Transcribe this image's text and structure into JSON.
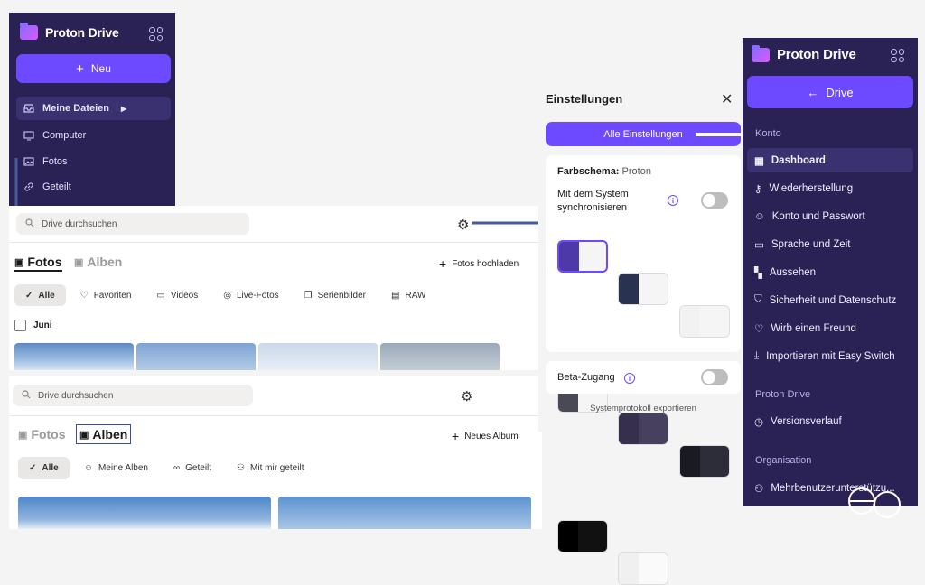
{
  "left_sidebar": {
    "brand": "Proton Drive",
    "new_label": "Neu",
    "items": [
      {
        "label": "Meine Dateien"
      },
      {
        "label": "Computer"
      },
      {
        "label": "Fotos"
      },
      {
        "label": "Geteilt"
      }
    ]
  },
  "photos_view": {
    "search_placeholder": "Drive durchsuchen",
    "tab_fotos": "Fotos",
    "tab_alben": "Alben",
    "upload_label": "Fotos hochladen",
    "filters": [
      "Alle",
      "Favoriten",
      "Videos",
      "Live-Fotos",
      "Serienbilder",
      "RAW"
    ],
    "month": "Juni"
  },
  "albums_view": {
    "search_placeholder": "Drive durchsuchen",
    "tab_fotos": "Fotos",
    "tab_alben": "Alben",
    "new_album_label": "Neues Album",
    "filters": [
      "Alle",
      "Meine Alben",
      "Geteilt",
      "Mit mir geteilt"
    ]
  },
  "settings": {
    "title": "Einstellungen",
    "all_settings": "Alle Einstellungen",
    "scheme_label": "Farbschema:",
    "scheme_value": "Proton",
    "sync_label": "Mit dem System synchronisieren",
    "beta_label": "Beta-Zugang",
    "export_label": "Systemprotokoll exportieren"
  },
  "right_sidebar": {
    "brand": "Proton Drive",
    "back_label": "Drive",
    "section_account": "Konto",
    "account_items": [
      "Dashboard",
      "Wiederherstellung",
      "Konto und Passwort",
      "Sprache und Zeit",
      "Aussehen",
      "Sicherheit und Datenschutz",
      "Wirb einen Freund",
      "Importieren mit Easy Switch"
    ],
    "section_drive": "Proton Drive",
    "drive_items": [
      "Versionsverlauf"
    ],
    "section_org": "Organisation",
    "org_items": [
      "Mehrbenutzerunterstützu..."
    ]
  },
  "colors": {
    "accent": "#6d4aff",
    "sidebar": "#2a2155"
  }
}
